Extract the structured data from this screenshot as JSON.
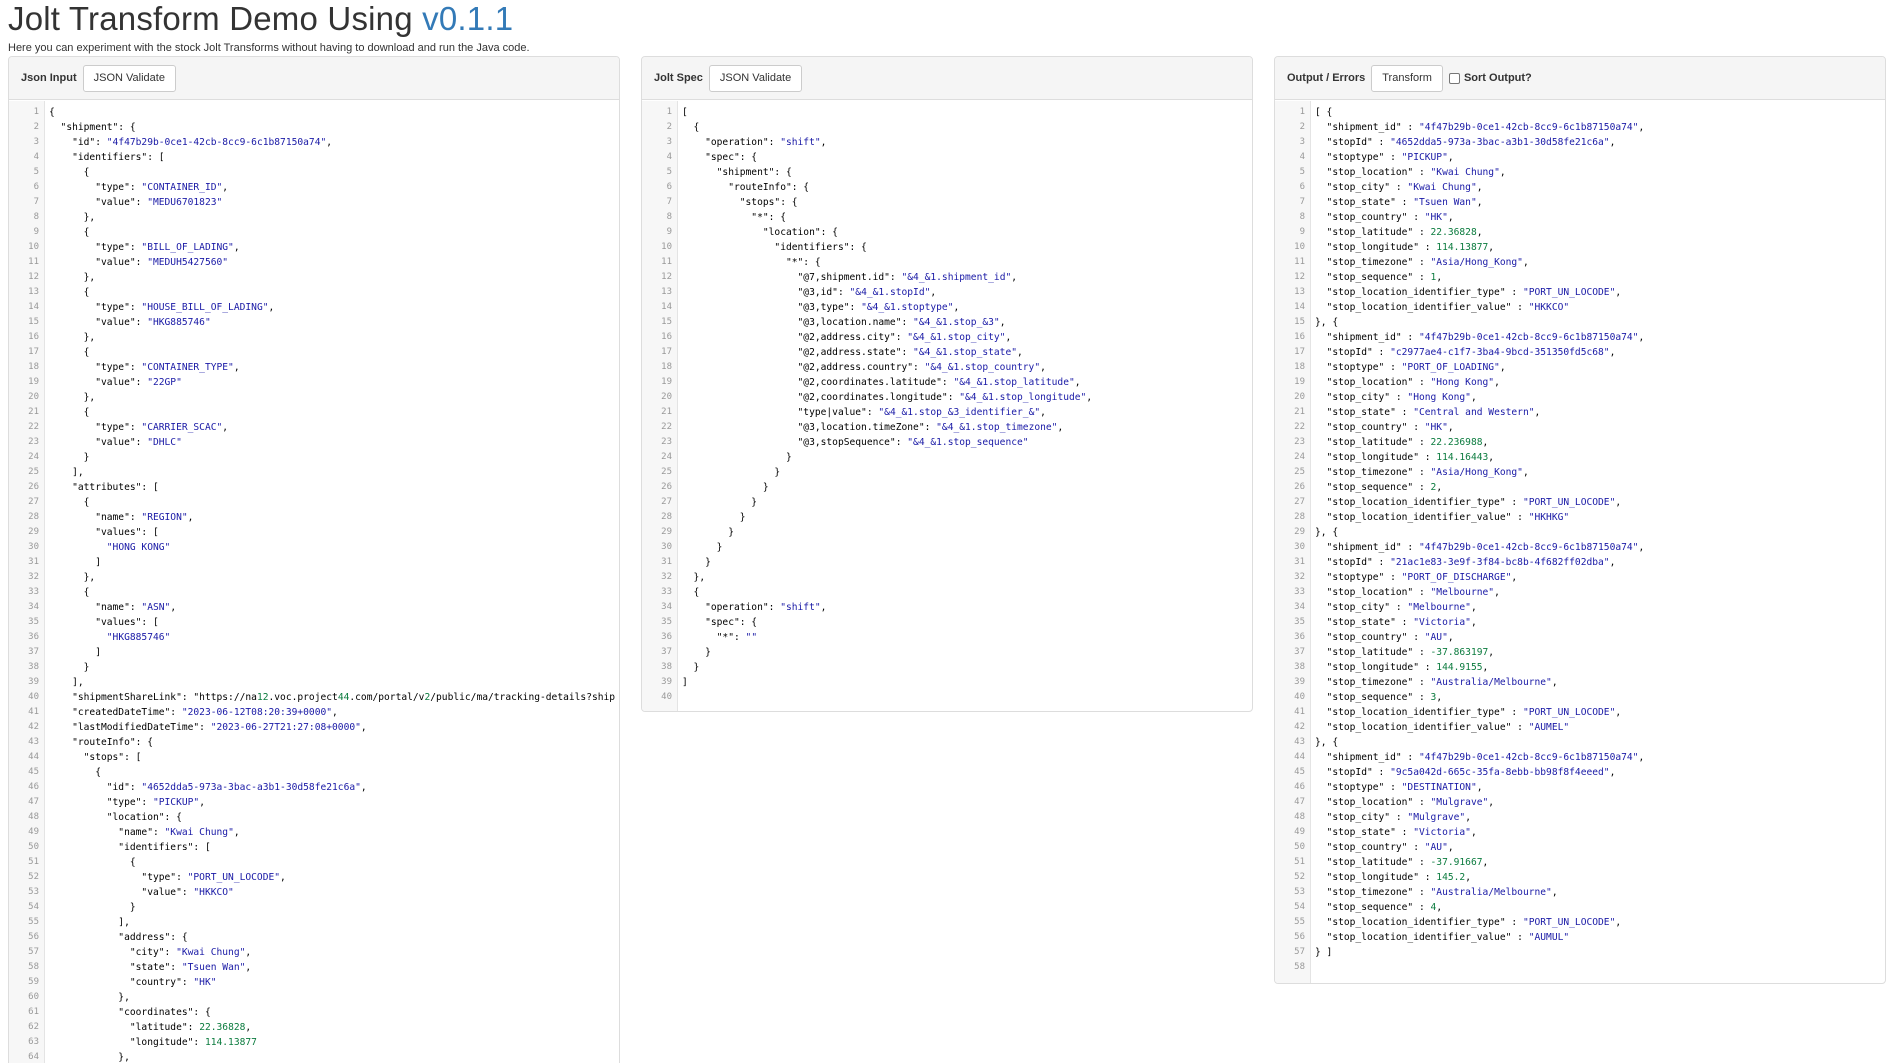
{
  "header": {
    "title_main": "Jolt Transform Demo Using ",
    "title_version": "v0.1.1",
    "subtitle": "Here you can experiment with the stock Jolt Transforms without having to download and run the Java code."
  },
  "panels": {
    "input": {
      "label": "Json Input",
      "button": "JSON Validate"
    },
    "spec": {
      "label": "Jolt Spec",
      "button": "JSON Validate"
    },
    "output": {
      "label": "Output / Errors",
      "button": "Transform",
      "checkbox_label": "Sort Output?"
    }
  },
  "input_lines": [
    "{",
    "  \"shipment\": {",
    "    \"id\": \"4f47b29b-0ce1-42cb-8cc9-6c1b87150a74\",",
    "    \"identifiers\": [",
    "      {",
    "        \"type\": \"CONTAINER_ID\",",
    "        \"value\": \"MEDU6701823\"",
    "      },",
    "      {",
    "        \"type\": \"BILL_OF_LADING\",",
    "        \"value\": \"MEDUH5427560\"",
    "      },",
    "      {",
    "        \"type\": \"HOUSE_BILL_OF_LADING\",",
    "        \"value\": \"HKG885746\"",
    "      },",
    "      {",
    "        \"type\": \"CONTAINER_TYPE\",",
    "        \"value\": \"22GP\"",
    "      },",
    "      {",
    "        \"type\": \"CARRIER_SCAC\",",
    "        \"value\": \"DHLC\"",
    "      }",
    "    ],",
    "    \"attributes\": [",
    "      {",
    "        \"name\": \"REGION\",",
    "        \"values\": [",
    "          \"HONG KONG\"",
    "        ]",
    "      },",
    "      {",
    "        \"name\": \"ASN\",",
    "        \"values\": [",
    "          \"HKG885746\"",
    "        ]",
    "      }",
    "    ],",
    "    \"shipmentShareLink\": \"https://na12.voc.project44.com/portal/v2/public/ma/tracking-details?ship",
    "    \"createdDateTime\": \"2023-06-12T08:20:39+0000\",",
    "    \"lastModifiedDateTime\": \"2023-06-27T21:27:08+0000\",",
    "    \"routeInfo\": {",
    "      \"stops\": [",
    "        {",
    "          \"id\": \"4652dda5-973a-3bac-a3b1-30d58fe21c6a\",",
    "          \"type\": \"PICKUP\",",
    "          \"location\": {",
    "            \"name\": \"Kwai Chung\",",
    "            \"identifiers\": [",
    "              {",
    "                \"type\": \"PORT_UN_LOCODE\",",
    "                \"value\": \"HKKCO\"",
    "              }",
    "            ],",
    "            \"address\": {",
    "              \"city\": \"Kwai Chung\",",
    "              \"state\": \"Tsuen Wan\",",
    "              \"country\": \"HK\"",
    "            },",
    "            \"coordinates\": {",
    "              \"latitude\": 22.36828,",
    "              \"longitude\": 114.13877",
    "            },"
  ],
  "spec_lines": [
    "[",
    "  {",
    "    \"operation\": \"shift\",",
    "    \"spec\": {",
    "      \"shipment\": {",
    "        \"routeInfo\": {",
    "          \"stops\": {",
    "            \"*\": {",
    "              \"location\": {",
    "                \"identifiers\": {",
    "                  \"*\": {",
    "                    \"@7,shipment.id\": \"&4_&1.shipment_id\",",
    "                    \"@3,id\": \"&4_&1.stopId\",",
    "                    \"@3,type\": \"&4_&1.stoptype\",",
    "                    \"@3,location.name\": \"&4_&1.stop_&3\",",
    "                    \"@2,address.city\": \"&4_&1.stop_city\",",
    "                    \"@2,address.state\": \"&4_&1.stop_state\",",
    "                    \"@2,address.country\": \"&4_&1.stop_country\",",
    "                    \"@2,coordinates.latitude\": \"&4_&1.stop_latitude\",",
    "                    \"@2,coordinates.longitude\": \"&4_&1.stop_longitude\",",
    "                    \"type|value\": \"&4_&1.stop_&3_identifier_&\",",
    "                    \"@3,location.timeZone\": \"&4_&1.stop_timezone\",",
    "                    \"@3,stopSequence\": \"&4_&1.stop_sequence\"",
    "                  }",
    "                }",
    "              }",
    "            }",
    "          }",
    "        }",
    "      }",
    "    }",
    "  },",
    "  {",
    "    \"operation\": \"shift\",",
    "    \"spec\": {",
    "      \"*\": \"\"",
    "    }",
    "  }",
    "]",
    ""
  ],
  "output_lines": [
    "[ {",
    "  \"shipment_id\" : \"4f47b29b-0ce1-42cb-8cc9-6c1b87150a74\",",
    "  \"stopId\" : \"4652dda5-973a-3bac-a3b1-30d58fe21c6a\",",
    "  \"stoptype\" : \"PICKUP\",",
    "  \"stop_location\" : \"Kwai Chung\",",
    "  \"stop_city\" : \"Kwai Chung\",",
    "  \"stop_state\" : \"Tsuen Wan\",",
    "  \"stop_country\" : \"HK\",",
    "  \"stop_latitude\" : 22.36828,",
    "  \"stop_longitude\" : 114.13877,",
    "  \"stop_timezone\" : \"Asia/Hong_Kong\",",
    "  \"stop_sequence\" : 1,",
    "  \"stop_location_identifier_type\" : \"PORT_UN_LOCODE\",",
    "  \"stop_location_identifier_value\" : \"HKKCO\"",
    "}, {",
    "  \"shipment_id\" : \"4f47b29b-0ce1-42cb-8cc9-6c1b87150a74\",",
    "  \"stopId\" : \"c2977ae4-c1f7-3ba4-9bcd-351350fd5c68\",",
    "  \"stoptype\" : \"PORT_OF_LOADING\",",
    "  \"stop_location\" : \"Hong Kong\",",
    "  \"stop_city\" : \"Hong Kong\",",
    "  \"stop_state\" : \"Central and Western\",",
    "  \"stop_country\" : \"HK\",",
    "  \"stop_latitude\" : 22.236988,",
    "  \"stop_longitude\" : 114.16443,",
    "  \"stop_timezone\" : \"Asia/Hong_Kong\",",
    "  \"stop_sequence\" : 2,",
    "  \"stop_location_identifier_type\" : \"PORT_UN_LOCODE\",",
    "  \"stop_location_identifier_value\" : \"HKHKG\"",
    "}, {",
    "  \"shipment_id\" : \"4f47b29b-0ce1-42cb-8cc9-6c1b87150a74\",",
    "  \"stopId\" : \"21ac1e83-3e9f-3f84-bc8b-4f682ff02dba\",",
    "  \"stoptype\" : \"PORT_OF_DISCHARGE\",",
    "  \"stop_location\" : \"Melbourne\",",
    "  \"stop_city\" : \"Melbourne\",",
    "  \"stop_state\" : \"Victoria\",",
    "  \"stop_country\" : \"AU\",",
    "  \"stop_latitude\" : -37.863197,",
    "  \"stop_longitude\" : 144.9155,",
    "  \"stop_timezone\" : \"Australia/Melbourne\",",
    "  \"stop_sequence\" : 3,",
    "  \"stop_location_identifier_type\" : \"PORT_UN_LOCODE\",",
    "  \"stop_location_identifier_value\" : \"AUMEL\"",
    "}, {",
    "  \"shipment_id\" : \"4f47b29b-0ce1-42cb-8cc9-6c1b87150a74\",",
    "  \"stopId\" : \"9c5a042d-665c-35fa-8ebb-bb98f8f4eeed\",",
    "  \"stoptype\" : \"DESTINATION\",",
    "  \"stop_location\" : \"Mulgrave\",",
    "  \"stop_city\" : \"Mulgrave\",",
    "  \"stop_state\" : \"Victoria\",",
    "  \"stop_country\" : \"AU\",",
    "  \"stop_latitude\" : -37.91667,",
    "  \"stop_longitude\" : 145.2,",
    "  \"stop_timezone\" : \"Australia/Melbourne\",",
    "  \"stop_sequence\" : 4,",
    "  \"stop_location_identifier_type\" : \"PORT_UN_LOCODE\",",
    "  \"stop_location_identifier_value\" : \"AUMUL\"",
    "} ]",
    ""
  ]
}
